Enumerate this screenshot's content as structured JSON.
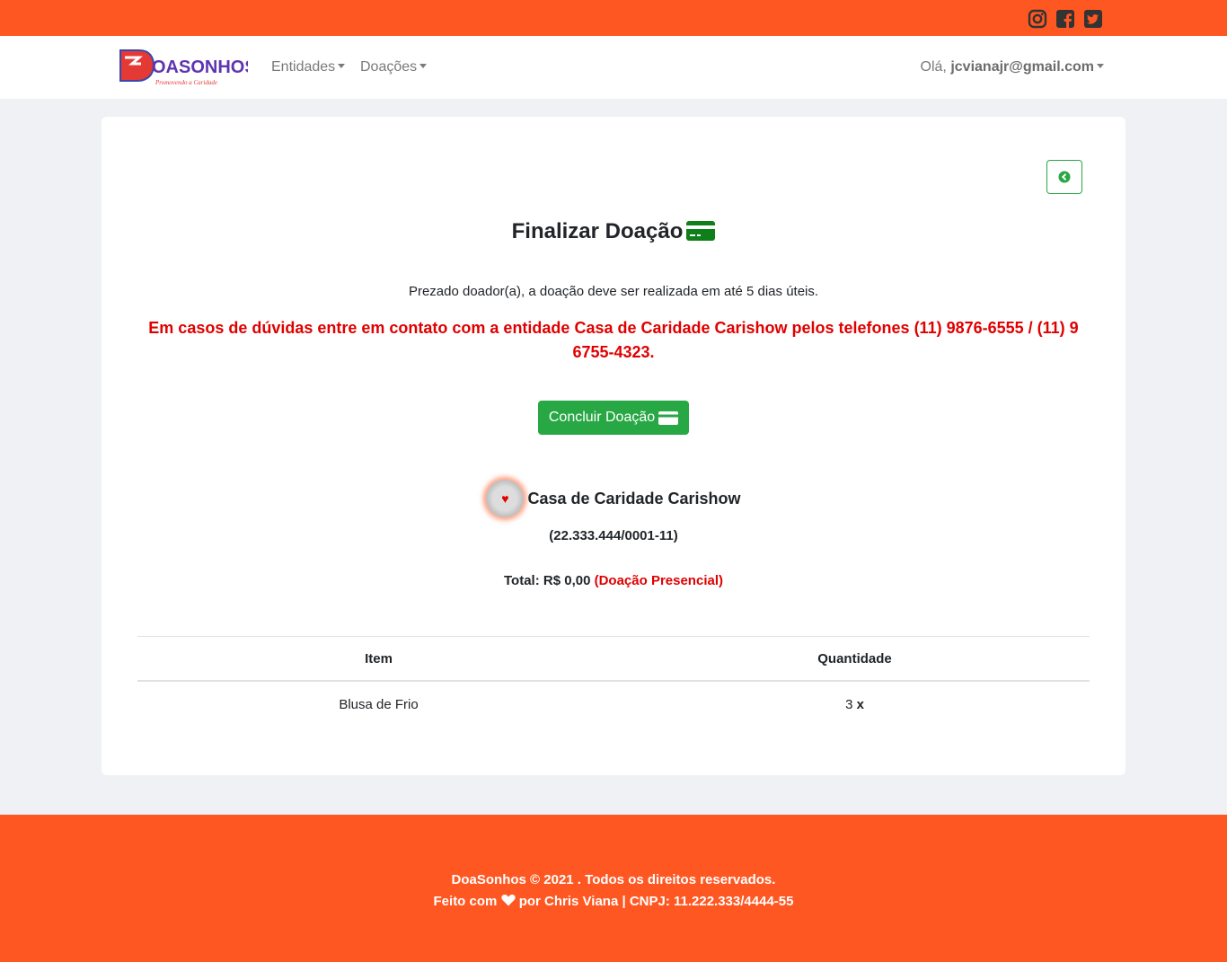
{
  "colors": {
    "brand_orange": "#ff5722",
    "success_green": "#28a745",
    "alert_red": "#e00000"
  },
  "topbar": {
    "icons": [
      "instagram-icon",
      "facebook-icon",
      "twitter-icon"
    ]
  },
  "navbar": {
    "logo_text": "OASONHOS",
    "logo_tagline": "Promovendo a Caridade",
    "menu": [
      {
        "label": "Entidades"
      },
      {
        "label": "Doações"
      }
    ],
    "greeting": "Olá,",
    "user_email": "jcvianajr@gmail.com"
  },
  "main": {
    "title": "Finalizar Doação",
    "notice": "Prezado doador(a), a doação deve ser realizada em até 5 dias úteis.",
    "contact": "Em casos de dúvidas entre em contato com a entidade Casa de Caridade Carishow pelos telefones (11) 9876-6555 / (11) 9 6755-4323.",
    "conclude_label": "Concluir Doação",
    "entity_name": "Casa de Caridade Carishow",
    "entity_cnpj": "(22.333.444/0001-11)",
    "total_label": "Total: R$ 0,00",
    "total_mode": "(Doação Presencial)"
  },
  "table": {
    "headers": [
      "Item",
      "Quantidade"
    ],
    "rows": [
      {
        "item": "Blusa de Frio",
        "qty": "3",
        "qty_suffix": "x"
      }
    ]
  },
  "footer": {
    "line1": "DoaSonhos © 2021 . Todos os direitos reservados.",
    "line2_prefix": "Feito com",
    "line2_suffix": "por Chris Viana | CNPJ: 11.222.333/4444-55"
  }
}
